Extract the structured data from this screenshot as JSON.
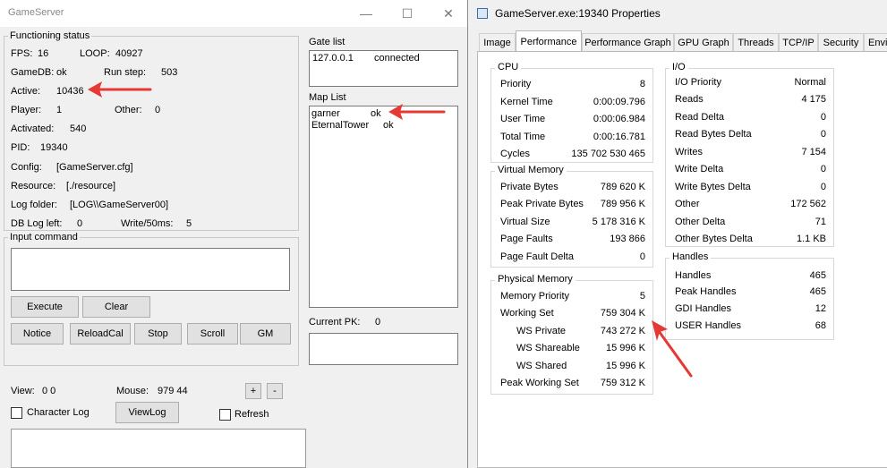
{
  "gameserver": {
    "title": "GameServer",
    "status": {
      "legend": "Functioning status",
      "fps_label": "FPS:",
      "fps_value": "16",
      "loop_label": "LOOP:",
      "loop_value": "40927",
      "gamedb_label": "GameDB:",
      "gamedb_value": "ok",
      "runstep_label": "Run step:",
      "runstep_value": "503",
      "active_label": "Active:",
      "active_value": "10436",
      "player_label": "Player:",
      "player_value": "1",
      "other_label": "Other:",
      "other_value": "0",
      "activated_label": "Activated:",
      "activated_value": "540",
      "pid_label": "PID:",
      "pid_value": "19340",
      "config_label": "Config:",
      "config_value": "[GameServer.cfg]",
      "resource_label": "Resource:",
      "resource_value": "[./resource]",
      "logfolder_label": "Log folder:",
      "logfolder_value": "[LOG\\\\GameServer00]",
      "dblog_label": "DB Log left:",
      "dblog_value": "0",
      "write_label": "Write/50ms:",
      "write_value": "5"
    },
    "gate_list": {
      "label": "Gate list",
      "rows": [
        {
          "name": "127.0.0.1",
          "state": "connected"
        }
      ]
    },
    "map_list": {
      "label": "Map List",
      "rows": [
        {
          "name": "garner",
          "state": "ok"
        },
        {
          "name": "EternalTower",
          "state": "ok"
        }
      ]
    },
    "input": {
      "legend": "Input command",
      "execute": "Execute",
      "clear": "Clear",
      "notice": "Notice",
      "reloadcal": "ReloadCal",
      "stop": "Stop",
      "scroll": "Scroll",
      "gm": "GM"
    },
    "current_pk_label": "Current PK:",
    "current_pk_value": "0",
    "view_label": "View:",
    "view_value": "0  0",
    "mouse_label": "Mouse:",
    "mouse_value": "979  44",
    "plus": "+",
    "minus": "-",
    "character_log": "Character Log",
    "viewlog": "ViewLog",
    "refresh": "Refresh"
  },
  "props": {
    "title": "GameServer.exe:19340 Properties",
    "tabs": [
      "Image",
      "Performance",
      "Performance Graph",
      "GPU Graph",
      "Threads",
      "TCP/IP",
      "Security",
      "Envi"
    ],
    "active_tab": "Performance",
    "cpu": {
      "title": "CPU",
      "rows": [
        {
          "label": "Priority",
          "value": "8"
        },
        {
          "label": "Kernel Time",
          "value": "0:00:09.796"
        },
        {
          "label": "User Time",
          "value": "0:00:06.984"
        },
        {
          "label": "Total Time",
          "value": "0:00:16.781"
        },
        {
          "label": "Cycles",
          "value": "135 702 530 465"
        }
      ]
    },
    "virtual_memory": {
      "title": "Virtual Memory",
      "rows": [
        {
          "label": "Private Bytes",
          "value": "789 620 K"
        },
        {
          "label": "Peak Private Bytes",
          "value": "789 956 K"
        },
        {
          "label": "Virtual Size",
          "value": "5 178 316 K"
        },
        {
          "label": "Page Faults",
          "value": "193 866"
        },
        {
          "label": "Page Fault Delta",
          "value": "0"
        }
      ]
    },
    "physical_memory": {
      "title": "Physical Memory",
      "rows": [
        {
          "label": "Memory Priority",
          "value": "5"
        },
        {
          "label": "Working Set",
          "value": "759 304 K"
        },
        {
          "label": "WS Private",
          "value": "743 272 K"
        },
        {
          "label": "WS Shareable",
          "value": "15 996 K"
        },
        {
          "label": "WS Shared",
          "value": "15 996 K"
        },
        {
          "label": "Peak Working Set",
          "value": "759 312 K"
        }
      ]
    },
    "io": {
      "title": "I/O",
      "rows": [
        {
          "label": "I/O Priority",
          "value": "Normal"
        },
        {
          "label": "Reads",
          "value": "4 175"
        },
        {
          "label": "Read Delta",
          "value": "0"
        },
        {
          "label": "Read Bytes Delta",
          "value": "0"
        },
        {
          "label": "Writes",
          "value": "7 154"
        },
        {
          "label": "Write Delta",
          "value": "0"
        },
        {
          "label": "Write Bytes Delta",
          "value": "0"
        },
        {
          "label": "Other",
          "value": "172 562"
        },
        {
          "label": "Other Delta",
          "value": "71"
        },
        {
          "label": "Other Bytes Delta",
          "value": "1.1  KB"
        }
      ]
    },
    "handles": {
      "title": "Handles",
      "rows": [
        {
          "label": "Handles",
          "value": "465"
        },
        {
          "label": "Peak Handles",
          "value": "465"
        },
        {
          "label": "GDI Handles",
          "value": "12"
        },
        {
          "label": "USER Handles",
          "value": "68"
        }
      ]
    }
  },
  "colors": {
    "annotation_arrow": "#e53935",
    "window_bg": "#f0f0f0"
  }
}
